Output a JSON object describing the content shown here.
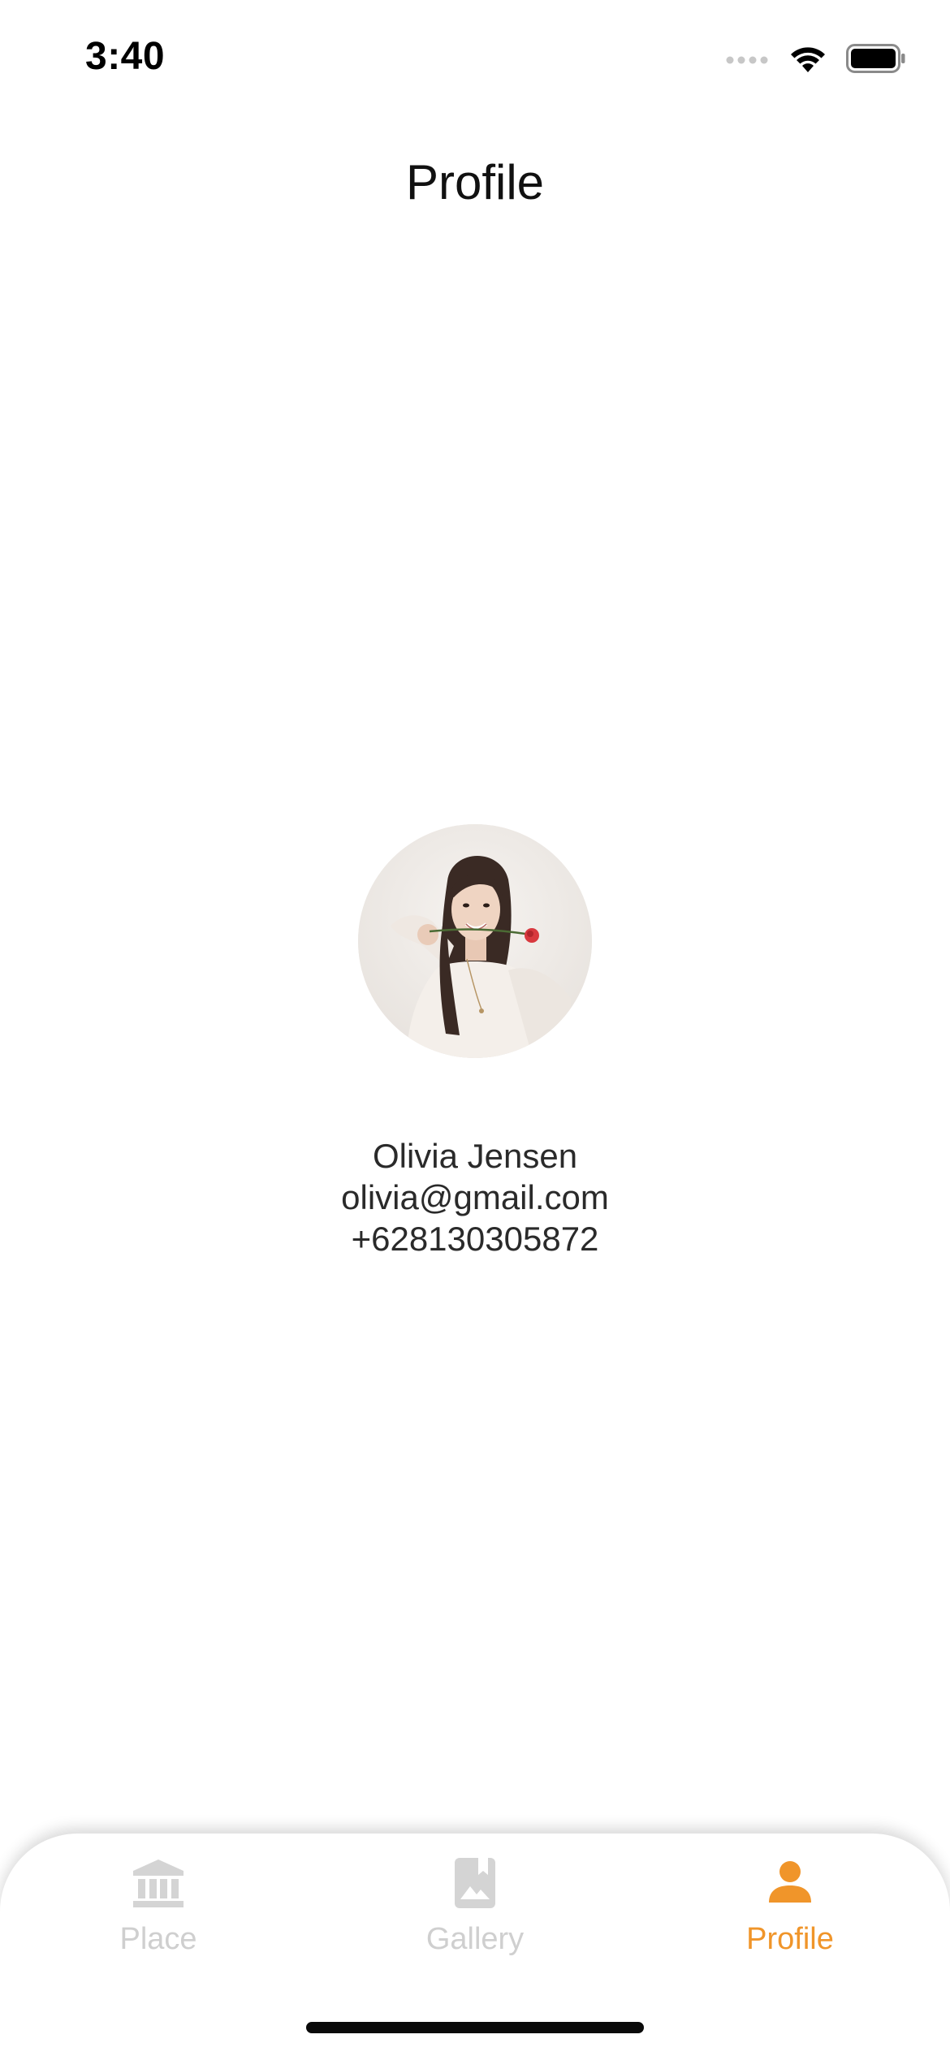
{
  "status_bar": {
    "time": "3:40",
    "signal_icon": "cellular-signal-icon",
    "wifi_icon": "wifi-icon",
    "battery_icon": "battery-icon"
  },
  "header": {
    "title": "Profile"
  },
  "profile": {
    "avatar_icon": "profile-photo",
    "name": "Olivia Jensen",
    "email": "olivia@gmail.com",
    "phone": "+628130305872"
  },
  "bottom_nav": {
    "items": [
      {
        "label": "Place",
        "icon": "bank-icon",
        "active": false
      },
      {
        "label": "Gallery",
        "icon": "photo-bookmark-icon",
        "active": false
      },
      {
        "label": "Profile",
        "icon": "person-icon",
        "active": true
      }
    ],
    "active_color": "#f0952a",
    "inactive_color": "#cfcfcf"
  }
}
